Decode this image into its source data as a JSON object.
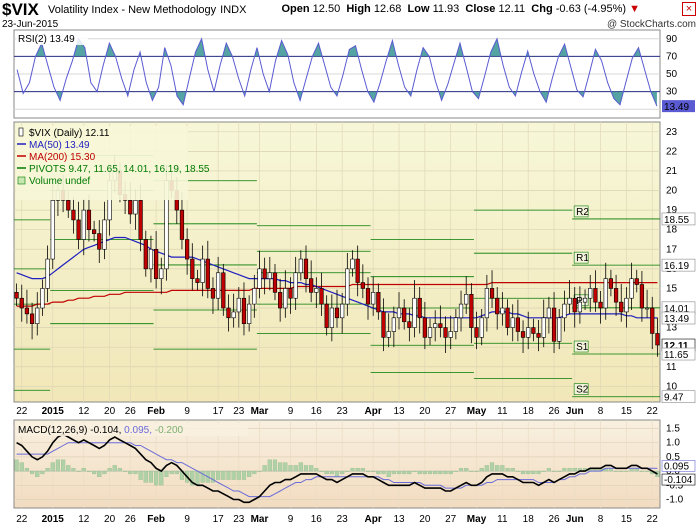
{
  "header": {
    "symbol": "$VIX",
    "name": "Volatility Index - New Methodology",
    "exchange": "INDX",
    "date": "23-Jun-2015",
    "open_label": "Open",
    "open": "12.50",
    "high_label": "High",
    "high": "12.68",
    "low_label": "Low",
    "low": "11.93",
    "close_label": "Close",
    "close": "12.11",
    "chg_label": "Chg",
    "chg": "-0.63 (-4.95%)",
    "chg_arrow": "▼",
    "brand": "@ StockCharts.com",
    "close_icon": "×"
  },
  "colors": {
    "bull": "#ffffff",
    "bear": "#c00000",
    "ma50": "#1f1fbf",
    "ma200": "#c00000",
    "pivot": "#007a00",
    "rsi": "#5a5ad2",
    "rsi_fill": "#2a8c8c",
    "macd": "#000000",
    "signal": "#6b6bd8",
    "hist": "#b0d0a8"
  },
  "chart_data": [
    {
      "type": "line",
      "panel": "rsi",
      "legend": "RSI(2) 13.49",
      "y_ticks": [
        10,
        30,
        50,
        70,
        90
      ],
      "ylim": [
        0,
        100
      ],
      "levels": [
        30,
        70
      ],
      "last_value_label": "13.49",
      "values": [
        55,
        28,
        40,
        70,
        85,
        60,
        35,
        20,
        45,
        65,
        90,
        80,
        40,
        30,
        60,
        85,
        70,
        45,
        25,
        55,
        75,
        40,
        20,
        35,
        80,
        60,
        25,
        15,
        45,
        75,
        90,
        55,
        30,
        60,
        85,
        70,
        45,
        25,
        55,
        80,
        50,
        30,
        65,
        88,
        72,
        40,
        20,
        45,
        70,
        85,
        60,
        35,
        25,
        50,
        78,
        82,
        55,
        30,
        18,
        40,
        65,
        88,
        60,
        35,
        25,
        55,
        80,
        70,
        42,
        20,
        38,
        62,
        85,
        58,
        30,
        22,
        48,
        75,
        90,
        60,
        35,
        25,
        52,
        76,
        50,
        30,
        18,
        45,
        70,
        84,
        58,
        32,
        24,
        50,
        78,
        65,
        40,
        22,
        15,
        42,
        68,
        80,
        55,
        30,
        13.49
      ]
    },
    {
      "type": "candlestick",
      "panel": "price",
      "legend": [
        "$VIX (Daily) 12.11",
        "MA(50) 13.49",
        "MA(200) 15.30",
        "PIVOTS 9.47, 11.65, 14.01, 16.19, 18.55",
        "Volume undef"
      ],
      "y_ticks": [
        10,
        11,
        12,
        13,
        14,
        15,
        16,
        17,
        18,
        19,
        20,
        21,
        22,
        23
      ],
      "ylim": [
        9.2,
        23.5
      ],
      "value_labels": [
        "18.55",
        "16.19",
        "14.01",
        "13.49",
        "12.11",
        "11.65",
        "9.47"
      ],
      "value_label_values": [
        18.55,
        16.19,
        14.01,
        13.49,
        12.11,
        11.65,
        9.47
      ],
      "pivot_labels": [
        "R2",
        "R1",
        "P",
        "S1",
        "S2"
      ],
      "pivot_values": [
        18.55,
        16.19,
        14.01,
        11.65,
        9.47
      ],
      "x_labels": [
        "22",
        "2015",
        "12",
        "20",
        "26",
        "Feb",
        "9",
        "17",
        "23",
        "Mar",
        "9",
        "16",
        "23",
        "Apr",
        "13",
        "20",
        "27",
        "May",
        "11",
        "18",
        "26",
        "Jun",
        "8",
        "15",
        "22"
      ],
      "x_label_index": [
        1,
        7,
        13,
        18,
        22,
        27,
        33,
        39,
        43,
        47,
        53,
        58,
        63,
        69,
        74,
        79,
        84,
        89,
        94,
        99,
        104,
        108,
        113,
        118,
        123
      ],
      "close": [
        14.5,
        14.0,
        13.7,
        13.2,
        14.0,
        15.0,
        16.5,
        19.5,
        20.0,
        19.5,
        19.0,
        18.5,
        17.5,
        19.0,
        18.0,
        17.8,
        17.0,
        18.5,
        20.5,
        21.0,
        19.8,
        19.5,
        18.8,
        19.5,
        17.5,
        16.0,
        17.0,
        15.5,
        16.0,
        20.5,
        20.0,
        19.0,
        17.5,
        16.5,
        15.5,
        15.3,
        16.5,
        15.0,
        14.5,
        15.8,
        14.0,
        13.5,
        13.8,
        14.5,
        13.2,
        14.2,
        15.0,
        16.0,
        15.5,
        15.8,
        14.8,
        14.0,
        15.0,
        14.5,
        15.8,
        16.5,
        15.5,
        14.8,
        15.0,
        14.2,
        13.0,
        14.0,
        13.5,
        14.2,
        16.0,
        16.5,
        15.3,
        15.0,
        14.2,
        14.8,
        13.8,
        12.5,
        12.8,
        13.5,
        14.0,
        13.3,
        13.0,
        14.5,
        13.5,
        12.5,
        13.0,
        13.2,
        13.0,
        12.5,
        12.8,
        13.5,
        14.2,
        14.7,
        13.0,
        12.5,
        13.5,
        15.0,
        14.5,
        13.7,
        14.0,
        13.0,
        13.5,
        12.8,
        12.5,
        13.0,
        12.7,
        12.5,
        13.5,
        14.0,
        12.3,
        13.5,
        14.2,
        14.5,
        13.8,
        14.3,
        14.5,
        15.0,
        14.3,
        14.0,
        15.5,
        15.0,
        14.3,
        13.8,
        14.5,
        15.5,
        15.2,
        14.0,
        14.0,
        12.7,
        12.11
      ],
      "ma50": [
        15.8,
        15.7,
        15.6,
        15.5,
        15.5,
        15.5,
        15.6,
        15.8,
        16.0,
        16.2,
        16.4,
        16.6,
        16.8,
        17.0,
        17.1,
        17.2,
        17.3,
        17.4,
        17.5,
        17.6,
        17.6,
        17.6,
        17.5,
        17.4,
        17.3,
        17.2,
        17.0,
        16.9,
        16.8,
        16.7,
        16.6,
        16.6,
        16.6,
        16.6,
        16.6,
        16.5,
        16.4,
        16.3,
        16.2,
        16.1,
        16.0,
        15.9,
        15.8,
        15.7,
        15.6,
        15.5,
        15.5,
        15.5,
        15.5,
        15.5,
        15.5,
        15.4,
        15.4,
        15.3,
        15.3,
        15.3,
        15.2,
        15.2,
        15.1,
        15.0,
        14.9,
        14.8,
        14.7,
        14.6,
        14.5,
        14.4,
        14.3,
        14.2,
        14.1,
        14.0,
        13.9,
        13.8,
        13.8,
        13.8,
        13.7,
        13.7,
        13.7,
        13.6,
        13.6,
        13.5,
        13.5,
        13.5,
        13.5,
        13.5,
        13.5,
        13.5,
        13.5,
        13.5,
        13.5,
        13.5,
        13.6,
        13.7,
        13.8,
        13.8,
        13.8,
        13.8,
        13.7,
        13.7,
        13.6,
        13.5,
        13.5,
        13.5,
        13.5,
        13.5,
        13.5,
        13.5,
        13.6,
        13.7,
        13.7,
        13.7,
        13.7,
        13.7,
        13.7,
        13.7,
        13.7,
        13.7,
        13.7,
        13.7,
        13.6,
        13.6,
        13.5,
        13.5,
        13.5,
        13.5,
        13.49
      ],
      "ma200": [
        14.1,
        14.1,
        14.1,
        14.1,
        14.2,
        14.2,
        14.2,
        14.3,
        14.3,
        14.3,
        14.4,
        14.4,
        14.5,
        14.5,
        14.5,
        14.6,
        14.6,
        14.6,
        14.7,
        14.7,
        14.7,
        14.8,
        14.8,
        14.8,
        14.8,
        14.8,
        14.8,
        14.8,
        14.8,
        14.8,
        14.9,
        14.9,
        14.9,
        14.9,
        14.9,
        14.9,
        14.9,
        14.9,
        14.9,
        14.9,
        14.9,
        14.9,
        14.9,
        14.9,
        14.9,
        14.9,
        15.0,
        15.0,
        15.0,
        15.0,
        15.0,
        15.0,
        15.0,
        15.0,
        15.1,
        15.1,
        15.1,
        15.1,
        15.1,
        15.1,
        15.1,
        15.1,
        15.1,
        15.1,
        15.1,
        15.2,
        15.2,
        15.2,
        15.2,
        15.2,
        15.2,
        15.2,
        15.2,
        15.2,
        15.2,
        15.2,
        15.2,
        15.2,
        15.2,
        15.2,
        15.2,
        15.2,
        15.2,
        15.2,
        15.2,
        15.2,
        15.2,
        15.2,
        15.2,
        15.2,
        15.2,
        15.2,
        15.3,
        15.3,
        15.3,
        15.3,
        15.3,
        15.3,
        15.3,
        15.3,
        15.3,
        15.3,
        15.3,
        15.3,
        15.3,
        15.3,
        15.3,
        15.3,
        15.3,
        15.3,
        15.3,
        15.3,
        15.3,
        15.3,
        15.3,
        15.3,
        15.3,
        15.3,
        15.3,
        15.3,
        15.3,
        15.3,
        15.3,
        15.3,
        15.3
      ]
    },
    {
      "type": "line",
      "panel": "macd",
      "legend_prefix": "MACD(12,26,9)",
      "legend_macd": "-0.104,",
      "legend_signal": "0.095,",
      "legend_hist": "-0.200",
      "y_ticks": [
        -1.0,
        -0.5,
        0.0,
        0.5,
        1.0,
        1.5
      ],
      "y_tick_labels": [
        "-1.0",
        "-0.5",
        "0.0",
        "0.5",
        "1.0",
        "1.5"
      ],
      "ylim": [
        -1.3,
        1.8
      ],
      "value_labels": [
        "0.095",
        "-0.104"
      ],
      "value_label_values": [
        0.095,
        -0.104
      ],
      "macd": [
        1.0,
        0.9,
        0.7,
        0.5,
        0.4,
        0.5,
        0.7,
        1.0,
        1.2,
        1.3,
        1.2,
        1.1,
        1.0,
        1.1,
        1.0,
        0.9,
        0.8,
        0.9,
        1.1,
        1.2,
        1.1,
        1.0,
        0.9,
        0.8,
        0.6,
        0.4,
        0.3,
        0.1,
        0.0,
        0.2,
        0.3,
        0.2,
        0.0,
        -0.2,
        -0.4,
        -0.5,
        -0.5,
        -0.6,
        -0.7,
        -0.7,
        -0.8,
        -0.9,
        -1.0,
        -1.0,
        -1.1,
        -1.1,
        -1.0,
        -0.9,
        -0.7,
        -0.5,
        -0.4,
        -0.4,
        -0.3,
        -0.3,
        -0.2,
        -0.1,
        -0.1,
        -0.1,
        -0.1,
        -0.2,
        -0.3,
        -0.3,
        -0.4,
        -0.3,
        -0.2,
        -0.1,
        -0.1,
        -0.1,
        -0.2,
        -0.2,
        -0.3,
        -0.4,
        -0.5,
        -0.5,
        -0.5,
        -0.5,
        -0.5,
        -0.4,
        -0.5,
        -0.6,
        -0.6,
        -0.6,
        -0.6,
        -0.7,
        -0.7,
        -0.6,
        -0.5,
        -0.4,
        -0.5,
        -0.5,
        -0.4,
        -0.2,
        -0.1,
        -0.1,
        -0.1,
        -0.2,
        -0.2,
        -0.3,
        -0.4,
        -0.4,
        -0.4,
        -0.5,
        -0.4,
        -0.3,
        -0.4,
        -0.3,
        -0.2,
        -0.1,
        -0.1,
        0.0,
        0.0,
        0.1,
        0.1,
        0.1,
        0.2,
        0.2,
        0.1,
        0.1,
        0.1,
        0.2,
        0.2,
        0.1,
        0.1,
        0.0,
        -0.104
      ],
      "signal": [
        0.6,
        0.6,
        0.6,
        0.6,
        0.6,
        0.6,
        0.6,
        0.7,
        0.8,
        0.9,
        1.0,
        1.0,
        1.0,
        1.0,
        1.0,
        1.0,
        1.0,
        1.0,
        1.0,
        1.0,
        1.0,
        1.0,
        1.0,
        0.9,
        0.9,
        0.8,
        0.7,
        0.6,
        0.5,
        0.4,
        0.4,
        0.3,
        0.3,
        0.2,
        0.1,
        0.0,
        -0.1,
        -0.2,
        -0.3,
        -0.4,
        -0.5,
        -0.6,
        -0.7,
        -0.7,
        -0.8,
        -0.9,
        -0.9,
        -0.9,
        -0.9,
        -0.9,
        -0.8,
        -0.7,
        -0.6,
        -0.5,
        -0.4,
        -0.4,
        -0.3,
        -0.3,
        -0.2,
        -0.2,
        -0.2,
        -0.2,
        -0.2,
        -0.2,
        -0.2,
        -0.2,
        -0.2,
        -0.2,
        -0.2,
        -0.2,
        -0.2,
        -0.3,
        -0.3,
        -0.4,
        -0.4,
        -0.4,
        -0.4,
        -0.4,
        -0.4,
        -0.5,
        -0.5,
        -0.5,
        -0.5,
        -0.6,
        -0.6,
        -0.6,
        -0.6,
        -0.5,
        -0.5,
        -0.5,
        -0.5,
        -0.4,
        -0.4,
        -0.3,
        -0.3,
        -0.3,
        -0.3,
        -0.3,
        -0.3,
        -0.3,
        -0.3,
        -0.4,
        -0.4,
        -0.4,
        -0.4,
        -0.3,
        -0.3,
        -0.2,
        -0.2,
        -0.1,
        -0.1,
        0.0,
        0.0,
        0.0,
        0.1,
        0.1,
        0.1,
        0.1,
        0.1,
        0.1,
        0.1,
        0.1,
        0.1,
        0.1,
        0.095
      ]
    }
  ]
}
